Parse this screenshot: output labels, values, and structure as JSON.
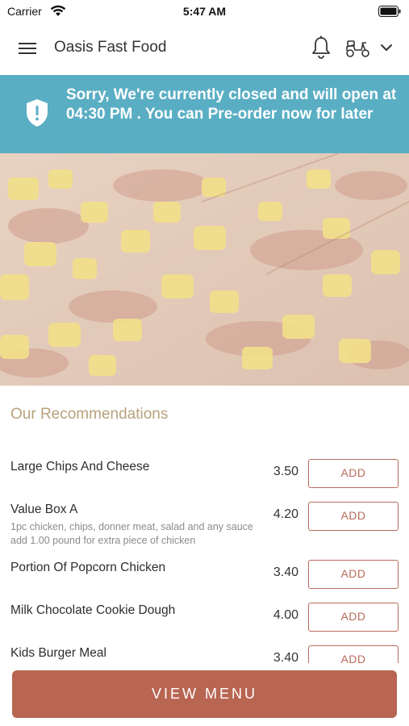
{
  "status_bar": {
    "carrier": "Carrier",
    "time": "5:47 AM"
  },
  "header": {
    "title": "Oasis Fast Food",
    "icons": [
      "hamburger-menu-icon",
      "bell-icon",
      "scooter-icon",
      "chevron-down-icon"
    ]
  },
  "banner": {
    "message": "Sorry, We're currently closed and will open at 04:30 PM . You can Pre-order now for later",
    "icon": "shield-alert-icon",
    "color": "#5aaec4"
  },
  "recommendations": {
    "title": "Our Recommendations",
    "items": [
      {
        "name": "Large Chips And Cheese",
        "description": "",
        "price": "3.50",
        "button": "ADD"
      },
      {
        "name": "Value Box A",
        "description": "1pc chicken, chips, donner meat, salad and any sauce add 1.00 pound  for extra piece of chicken",
        "price": "4.20",
        "button": "ADD"
      },
      {
        "name": "Portion Of Popcorn Chicken",
        "description": "",
        "price": "3.40",
        "button": "ADD"
      },
      {
        "name": "Milk Chocolate Cookie Dough",
        "description": "",
        "price": "4.00",
        "button": "ADD"
      },
      {
        "name": "Kids Burger Meal",
        "description": "",
        "price": "3.40",
        "button": "ADD"
      }
    ]
  },
  "footer": {
    "view_menu": "VIEW MENU",
    "accent": "#b86552"
  }
}
